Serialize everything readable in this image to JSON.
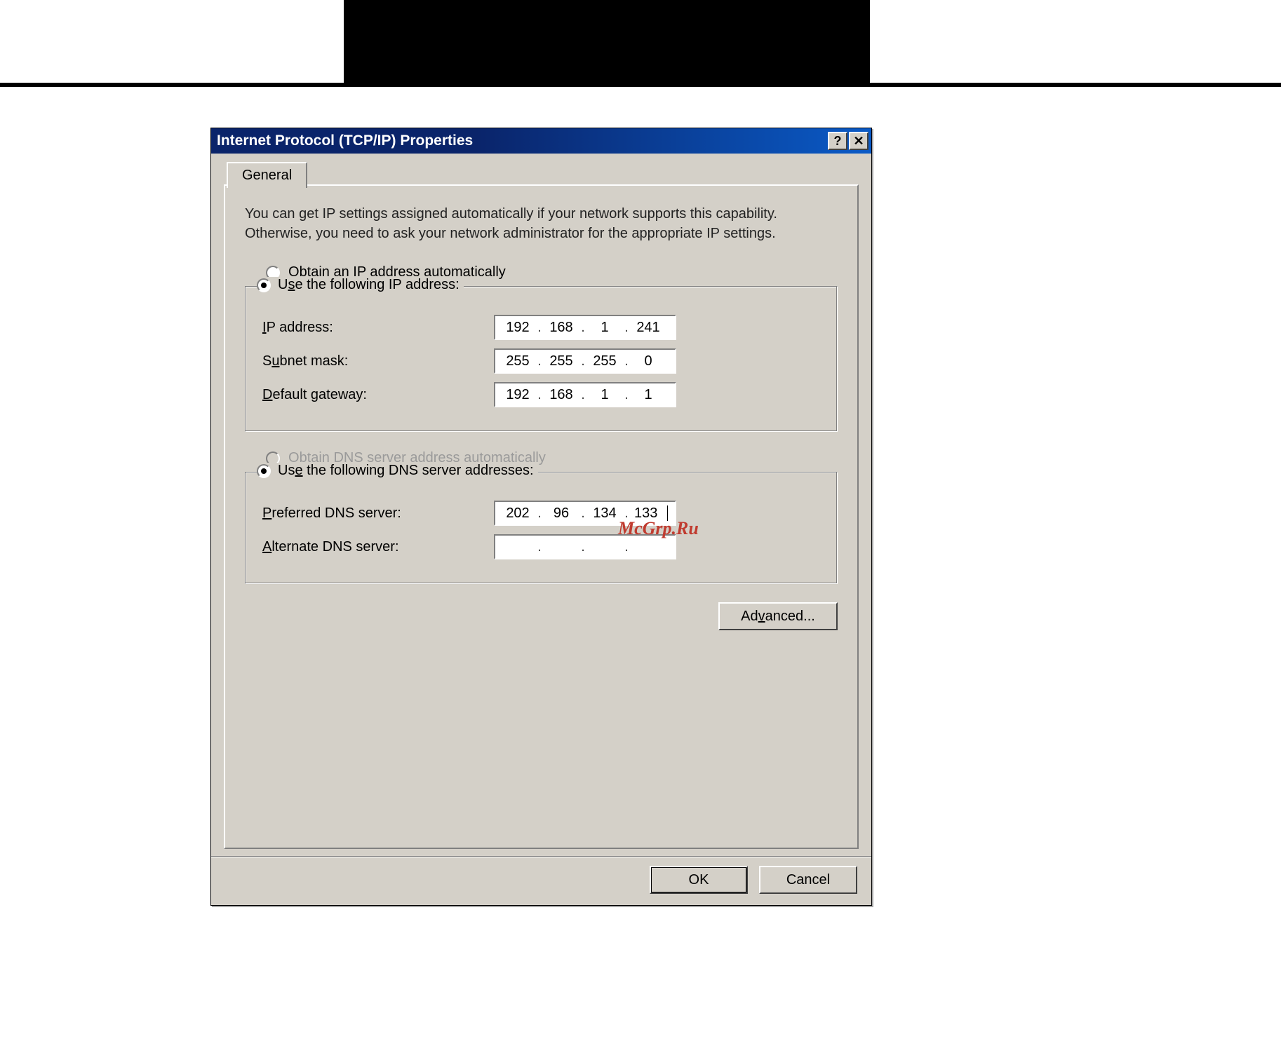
{
  "window": {
    "title": "Internet Protocol (TCP/IP) Properties"
  },
  "tab": {
    "general": "General"
  },
  "intro": "You can get IP settings assigned automatically if your network supports this capability. Otherwise, you need to ask your network administrator for the appropriate IP settings.",
  "radios": {
    "obtain_ip": "Obtain an IP address automatically",
    "use_ip": "Use the following IP address:",
    "obtain_dns": "Obtain DNS server address automatically",
    "use_dns": "Use the following DNS server addresses:"
  },
  "labels": {
    "ip_address": "IP address:",
    "subnet_mask": "Subnet mask:",
    "default_gateway": "Default gateway:",
    "preferred_dns": "Preferred DNS server:",
    "alternate_dns": "Alternate DNS server:"
  },
  "values": {
    "ip": [
      "192",
      "168",
      "1",
      "241"
    ],
    "subnet": [
      "255",
      "255",
      "255",
      "0"
    ],
    "gateway": [
      "192",
      "168",
      "1",
      "1"
    ],
    "pref_dns": [
      "202",
      "96",
      "134",
      "133"
    ],
    "alt_dns": [
      "",
      "",
      "",
      ""
    ]
  },
  "buttons": {
    "advanced": "Advanced...",
    "ok": "OK",
    "cancel": "Cancel"
  },
  "watermark": "McGrp.Ru"
}
